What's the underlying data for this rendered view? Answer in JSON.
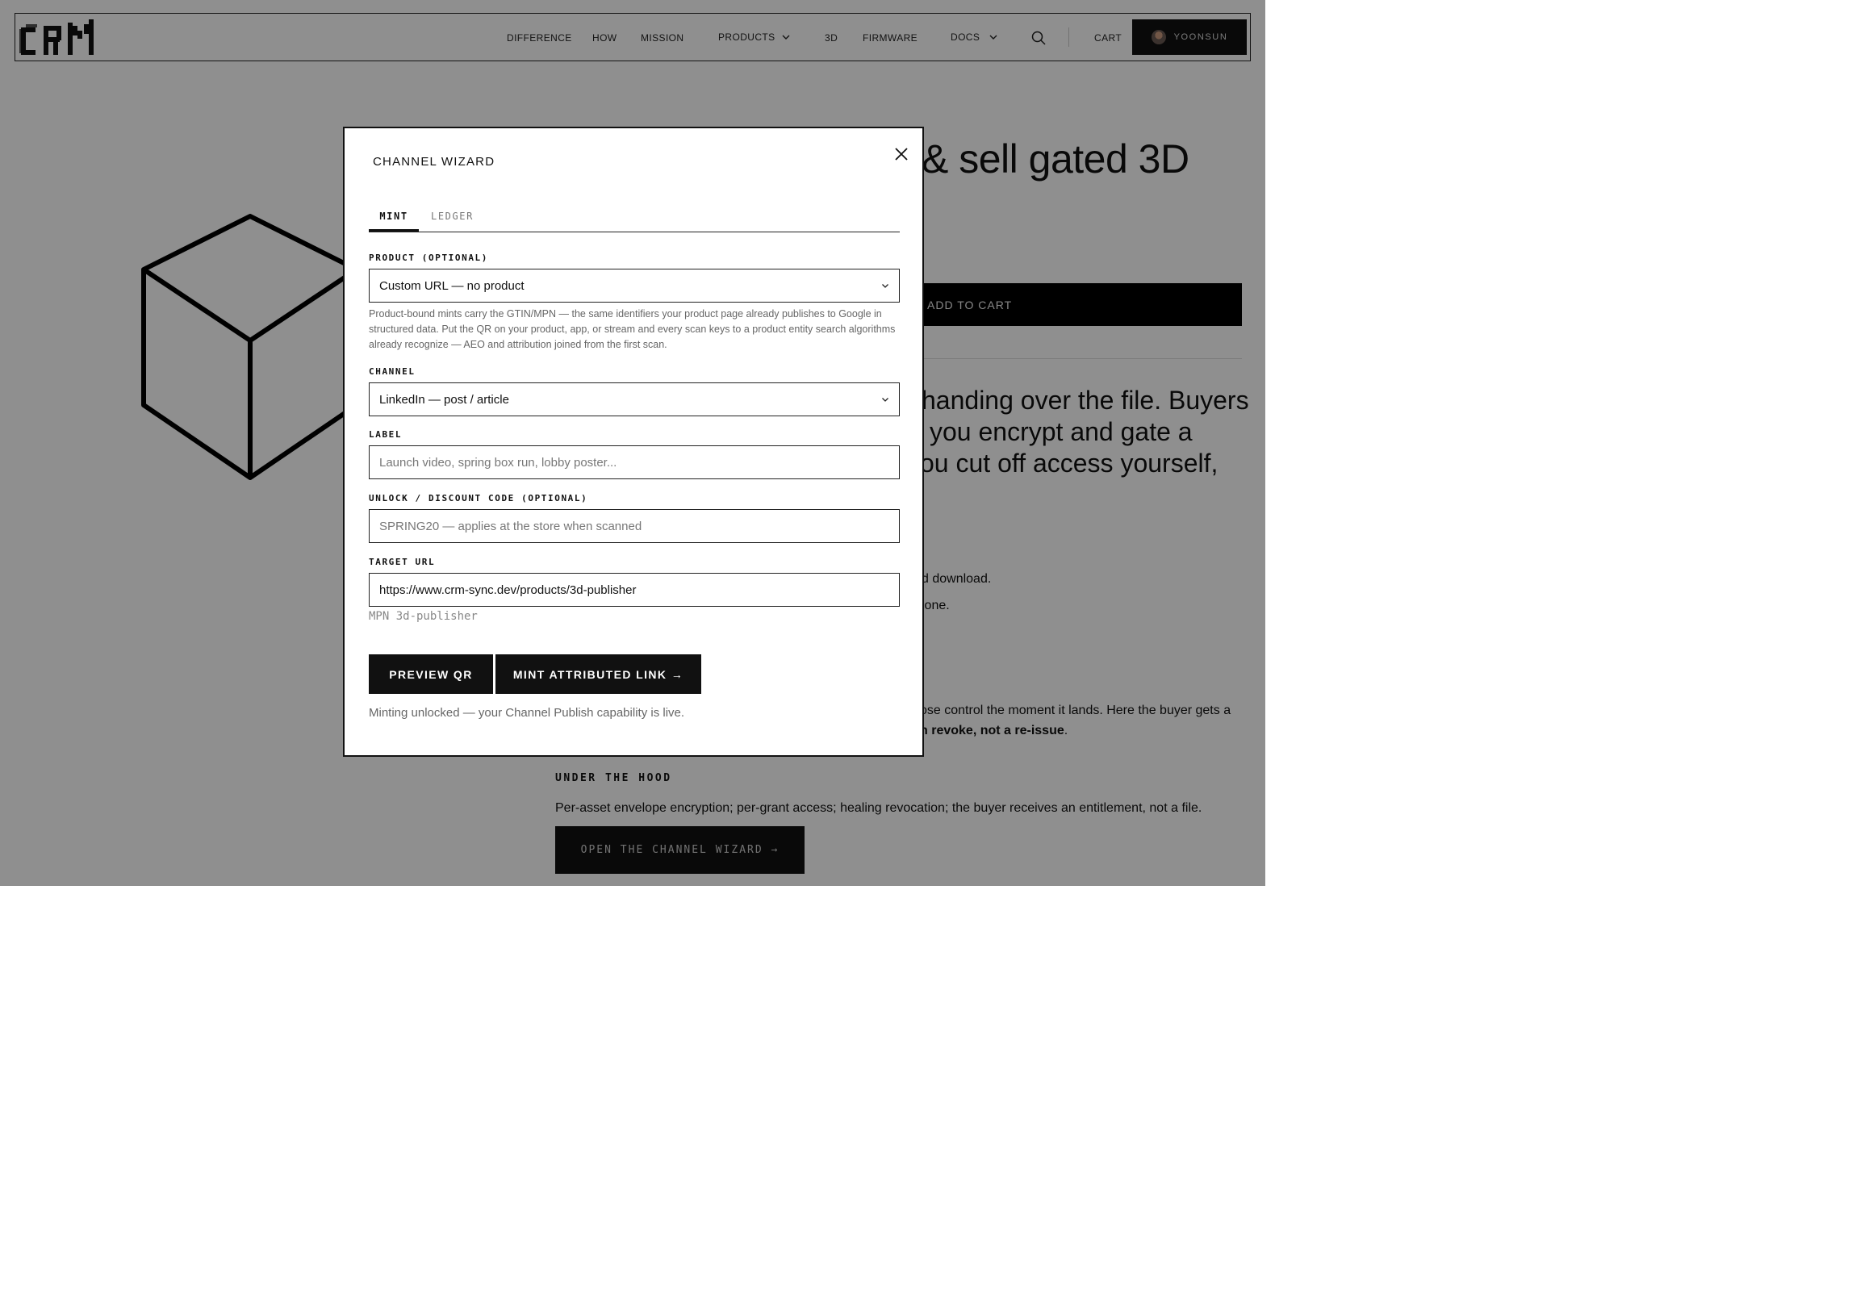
{
  "nav": {
    "logo": "CRM",
    "links": [
      "DIFFERENCE",
      "HOW",
      "MISSION",
      "PRODUCTS",
      "3D",
      "FIRMWARE",
      "DOCS"
    ],
    "cart": "CART",
    "user": "YOONSUN"
  },
  "hero": {
    "title_visible": "& sell gated 3D",
    "cart_button": "ADD TO CART",
    "lead_lines": [
      "handing over the file. Buyers",
      "you encrypt and gate a",
      "ou cut off access yourself,"
    ],
    "bullets": [
      "d download.",
      "lone."
    ],
    "para_line1": "ose control the moment it lands. Here the buyer gets a",
    "para_line2": "n revoke, not a re-issue",
    "para_line2_end": "."
  },
  "hood": {
    "title": "UNDER THE HOOD",
    "text": "Per-asset envelope encryption; per-grant access; healing revocation; the buyer receives an entitlement, not a file.",
    "button": "OPEN THE CHANNEL WIZARD →"
  },
  "modal": {
    "title": "CHANNEL WIZARD",
    "tabs": [
      {
        "label": "MINT",
        "active": true
      },
      {
        "label": "LEDGER",
        "active": false
      }
    ],
    "product": {
      "label": "PRODUCT (OPTIONAL)",
      "value": "Custom URL — no product",
      "help": "Product-bound mints carry the GTIN/MPN — the same identifiers your product page already publishes to Google in structured data. Put the QR on your product, app, or stream and every scan keys to a product entity search algorithms already recognize — AEO and attribution joined from the first scan."
    },
    "channel": {
      "label": "CHANNEL",
      "value": "LinkedIn — post / article"
    },
    "label_field": {
      "label": "LABEL",
      "placeholder": "Launch video, spring box run, lobby poster..."
    },
    "unlock": {
      "label": "UNLOCK / DISCOUNT CODE (OPTIONAL)",
      "placeholder": "SPRING20 — applies at the store when scanned"
    },
    "target": {
      "label": "TARGET URL",
      "value": "https://www.crm-sync.dev/products/3d-publisher",
      "mpn": "MPN 3d-publisher"
    },
    "buttons": {
      "preview": "PREVIEW QR",
      "mint": "MINT ATTRIBUTED LINK →"
    },
    "status": "Minting unlocked — your Channel Publish capability is live."
  },
  "icons": {
    "close": "close-icon",
    "search": "search-icon",
    "chevron": "chevron-down-icon",
    "cube": "cube-icon",
    "avatar": "avatar"
  }
}
